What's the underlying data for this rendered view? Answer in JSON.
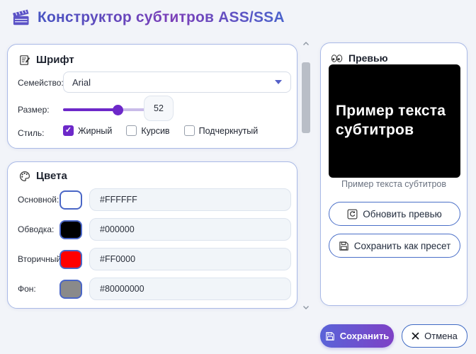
{
  "header": {
    "title": "Конструктор субтитров ASS/SSA"
  },
  "font_card": {
    "title": "Шрифт",
    "family_label": "Семейство:",
    "family_value": "Arial",
    "size_label": "Размер:",
    "size_value": "52",
    "size_percent": 65,
    "style_label": "Стиль:",
    "styles": [
      {
        "label": "Жирный",
        "checked": true
      },
      {
        "label": "Курсив",
        "checked": false
      },
      {
        "label": "Подчеркнутый",
        "checked": false
      }
    ]
  },
  "colors_card": {
    "title": "Цвета",
    "rows": [
      {
        "label": "Основной:",
        "swatch": "#ffffff",
        "value": "#FFFFFF"
      },
      {
        "label": "Обводка:",
        "swatch": "#000000",
        "value": "#000000"
      },
      {
        "label": "Вторичный:",
        "swatch": "#ff0000",
        "value": "#FF0000"
      },
      {
        "label": "Фон:",
        "swatch": "#8a8a8a",
        "value": "#80000000"
      }
    ]
  },
  "preview_card": {
    "title": "Превью",
    "preview_text": "Пример текста субтитров",
    "caption": "Пример текста субтитров",
    "update_label": "Обновить превью",
    "preset_label": "Сохранить как пресет"
  },
  "footer": {
    "save_label": "Сохранить",
    "cancel_label": "Отмена"
  },
  "ui_colors": {
    "accent": "#6d28c9",
    "card_border": "#a9b9e6",
    "button_border": "#4a6fc8",
    "title_start": "#4754c2",
    "title_mid": "#7b3eb8",
    "title_end": "#4a63cc",
    "save_gradient_start": "#5a63d8",
    "save_gradient_end": "#7e41c6",
    "page_bg": "#f2f4f9"
  }
}
